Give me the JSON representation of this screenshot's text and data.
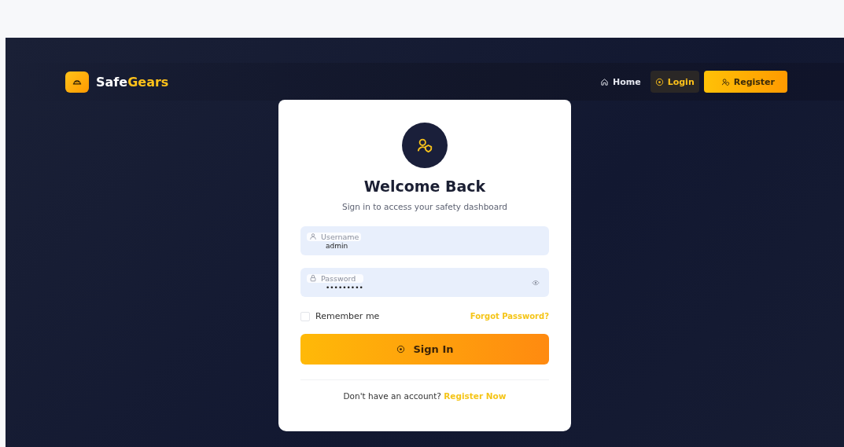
{
  "brand": {
    "name_start": "Safe",
    "name_end": "Gears"
  },
  "nav": [
    {
      "label": "Home",
      "kind": "link",
      "selected": false
    },
    {
      "label": "Login",
      "kind": "link",
      "selected": true
    },
    {
      "label": "Register",
      "kind": "button",
      "selected": false
    }
  ],
  "card": {
    "title": "Welcome Back",
    "subtitle": "Sign in to access your safety dashboard",
    "fields": [
      {
        "kind": "text",
        "label": "Username",
        "value": "admin"
      },
      {
        "kind": "password",
        "label": "Password",
        "value": "•••••••••"
      }
    ],
    "remember": {
      "label": "Remember me",
      "checked": false
    },
    "forgot": "Forgot Password?",
    "submit": "Sign In",
    "footer": {
      "text": "Don't have an account?",
      "link": "Register Now"
    }
  }
}
